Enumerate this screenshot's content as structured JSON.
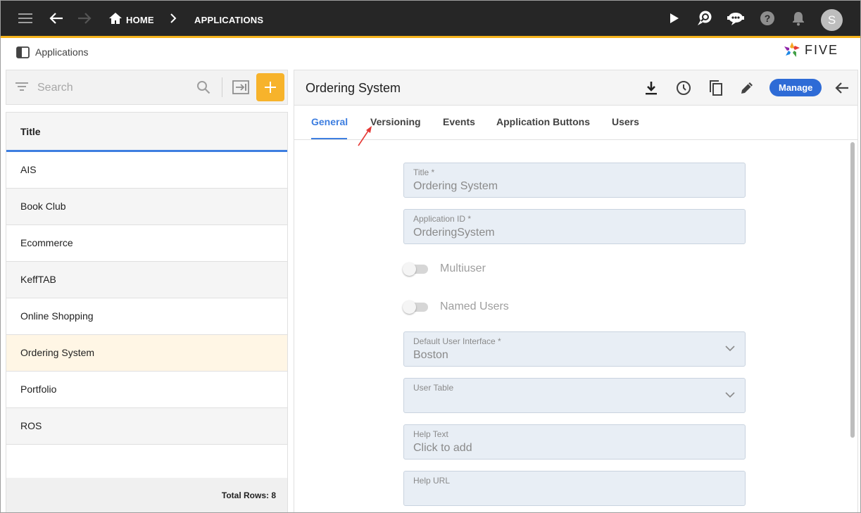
{
  "topbar": {
    "breadcrumb_home": "HOME",
    "breadcrumb_applications": "APPLICATIONS",
    "avatar_initial": "S",
    "accent_color": "#f5b31c"
  },
  "subheader": {
    "title": "Applications",
    "logo_text": "FIVE"
  },
  "left_panel": {
    "search_placeholder": "Search",
    "column_header": "Title",
    "rows": [
      {
        "label": "AIS"
      },
      {
        "label": "Book Club"
      },
      {
        "label": "Ecommerce"
      },
      {
        "label": "KeffTAB"
      },
      {
        "label": "Online Shopping"
      },
      {
        "label": "Ordering System"
      },
      {
        "label": "Portfolio"
      },
      {
        "label": "ROS"
      }
    ],
    "selected_row": "Ordering System",
    "total_rows": "Total Rows: 8"
  },
  "record": {
    "title": "Ordering System",
    "manage_label": "Manage",
    "tabs": [
      "General",
      "Versioning",
      "Events",
      "Application Buttons",
      "Users"
    ],
    "active_tab": "General",
    "fields": {
      "title": {
        "label": "Title *",
        "value": "Ordering System"
      },
      "app_id": {
        "label": "Application ID *",
        "value": "OrderingSystem"
      },
      "multiuser": {
        "label": "Multiuser",
        "on": false
      },
      "named_users": {
        "label": "Named Users",
        "on": false
      },
      "default_ui": {
        "label": "Default User Interface *",
        "value": "Boston"
      },
      "user_table": {
        "label": "User Table",
        "value": ""
      },
      "help_text": {
        "label": "Help Text",
        "value": "Click to add"
      },
      "help_url": {
        "label": "Help URL",
        "value": ""
      }
    }
  },
  "icons": [
    "menu-icon",
    "back-arrow-icon",
    "forward-arrow-icon",
    "home-icon",
    "chevron-right-icon",
    "play-icon",
    "chat-search-icon",
    "chat-bot-icon",
    "help-icon",
    "bell-icon",
    "panel-icon",
    "filter-icon",
    "search-icon",
    "import-icon",
    "plus-icon",
    "download-icon",
    "history-icon",
    "copy-icon",
    "edit-icon",
    "close-arrow-icon",
    "dropdown-chevron-icon"
  ]
}
